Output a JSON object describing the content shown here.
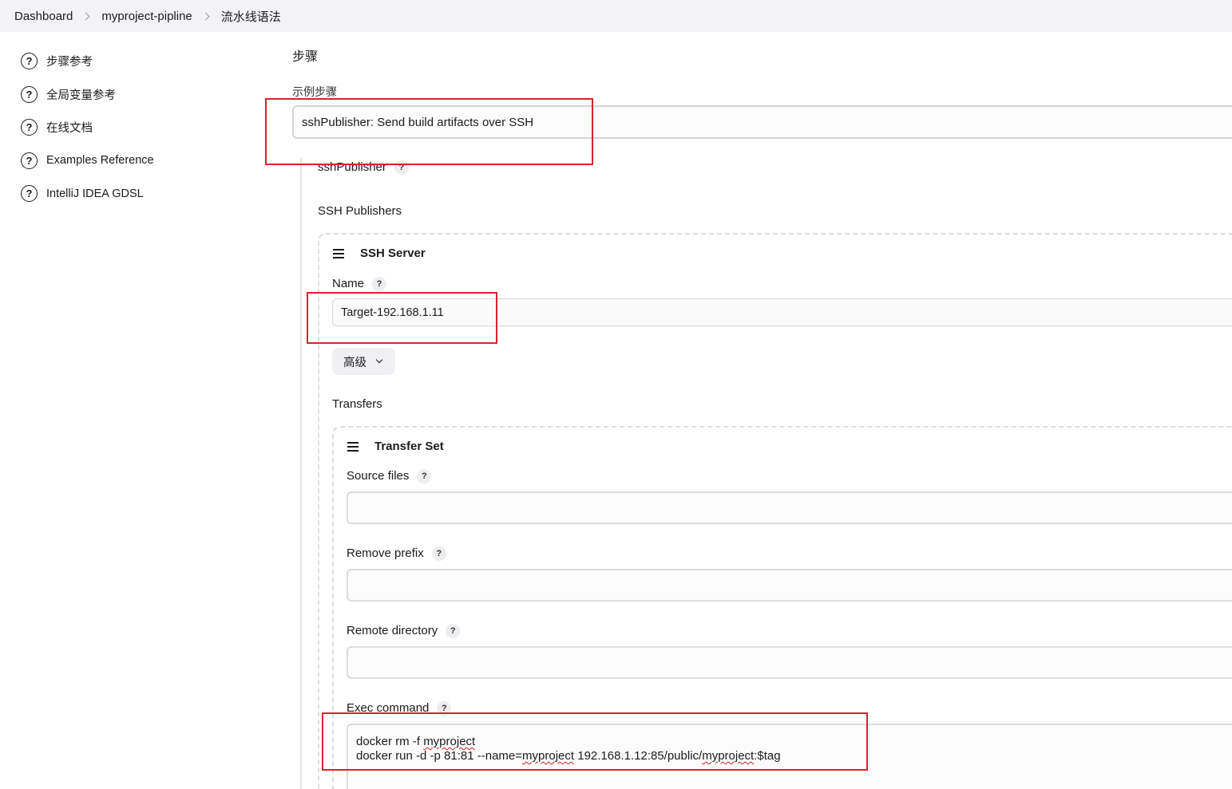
{
  "breadcrumb": [
    "Dashboard",
    "myproject-pipline",
    "流水线语法"
  ],
  "sidebar": {
    "items": [
      {
        "label": "步骤参考",
        "icon": "help-circle-icon"
      },
      {
        "label": "全局变量参考",
        "icon": "help-circle-icon"
      },
      {
        "label": "在线文档",
        "icon": "help-circle-icon"
      },
      {
        "label": "Examples Reference",
        "icon": "help-circle-icon"
      },
      {
        "label": "IntelliJ IDEA GDSL",
        "icon": "help-circle-icon"
      }
    ]
  },
  "main": {
    "section_title": "步骤",
    "sample_step_label": "示例步骤",
    "sample_step_value": "sshPublisher: Send build artifacts over SSH",
    "step_name_label": "sshPublisher",
    "ssh_publishers_label": "SSH Publishers",
    "ssh_server": {
      "title": "SSH Server",
      "name_label": "Name",
      "name_value": "Target-192.168.1.11",
      "advanced_label": "高级"
    },
    "transfers_label": "Transfers",
    "transfer_set": {
      "title": "Transfer Set",
      "source_files_label": "Source files",
      "source_files_value": "",
      "remove_prefix_label": "Remove prefix",
      "remove_prefix_value": "",
      "remote_directory_label": "Remote directory",
      "remote_directory_value": "",
      "exec_command_label": "Exec command",
      "exec_command_line1_pre": "docker rm -f ",
      "exec_command_line1_word": "myproject",
      "exec_command_line2_pre": "docker run -d -p 81:81 --name=",
      "exec_command_line2_word1": "myproject",
      "exec_command_line2_mid": " 192.168.1.12:85/public/",
      "exec_command_line2_word2": "myproject",
      "exec_command_line2_post": ":$tag"
    },
    "help_glyph": "?"
  },
  "colors": {
    "highlight_border": "#d9232d",
    "topbar_bg": "#f3f3f5"
  }
}
